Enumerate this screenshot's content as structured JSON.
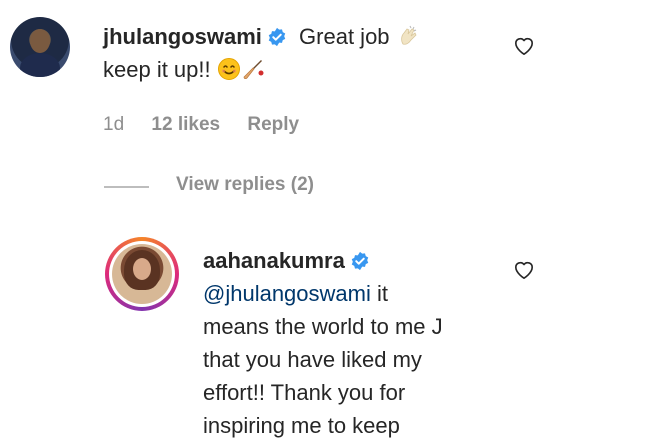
{
  "comment1": {
    "username": "jhulangoswami",
    "text_line1": "Great job",
    "text_line2": "keep it up!!",
    "age": "1d",
    "likes": "12 likes",
    "reply_label": "Reply"
  },
  "view_replies": "View replies (2)",
  "reply1": {
    "username": "aahanakumra",
    "mention": "@jhulangoswami",
    "lines": [
      "it",
      "means the world to me J",
      "that you have liked my",
      "effort!! Thank you for",
      "inspiring me to keep"
    ]
  },
  "colors": {
    "verified": "#3897f0",
    "mention": "#00376b",
    "meta": "#8e8e8e"
  },
  "icons": [
    "verified-badge-icon",
    "heart-icon",
    "clap-emoji-icon",
    "smile-emoji-icon",
    "cricket-bat-emoji-icon"
  ]
}
